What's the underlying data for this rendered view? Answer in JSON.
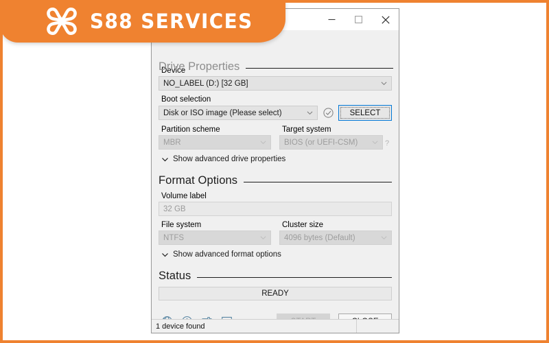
{
  "banner": {
    "brand": "S88 SERVICES",
    "logo_icon": "clover-knot-logo-icon",
    "color": "#ef8230"
  },
  "frame": {
    "border_color": "#ef8230"
  },
  "window": {
    "titlebar": {
      "minimize_label": "minimize-icon",
      "maximize_label": "maximize-icon",
      "close_label": "close-icon"
    },
    "sections": {
      "drive_properties": {
        "title": "Drive Properties",
        "device_label": "Device",
        "device_value": "NO_LABEL (D:) [32 GB]",
        "boot_selection_label": "Boot selection",
        "boot_selection_value": "Disk or ISO image (Please select)",
        "select_button": "SELECT",
        "check_icon": "check-circle-icon",
        "help_icon": "?",
        "partition_scheme_label": "Partition scheme",
        "partition_scheme_value": "MBR",
        "target_system_label": "Target system",
        "target_system_value": "BIOS (or UEFI-CSM)",
        "advanced_toggle": "Show advanced drive properties"
      },
      "format_options": {
        "title": "Format Options",
        "volume_label_label": "Volume label",
        "volume_label_value": "32 GB",
        "file_system_label": "File system",
        "file_system_value": "NTFS",
        "cluster_size_label": "Cluster size",
        "cluster_size_value": "4096 bytes (Default)",
        "advanced_toggle": "Show advanced format options"
      },
      "status": {
        "title": "Status",
        "progress_text": "READY"
      }
    },
    "toolbar_icons": [
      {
        "name": "language-globe-icon"
      },
      {
        "name": "info-icon"
      },
      {
        "name": "settings-sliders-icon"
      },
      {
        "name": "log-list-icon"
      }
    ],
    "buttons": {
      "start": "START",
      "close": "CLOSE"
    },
    "statusbar": {
      "text": "1 device found"
    }
  }
}
